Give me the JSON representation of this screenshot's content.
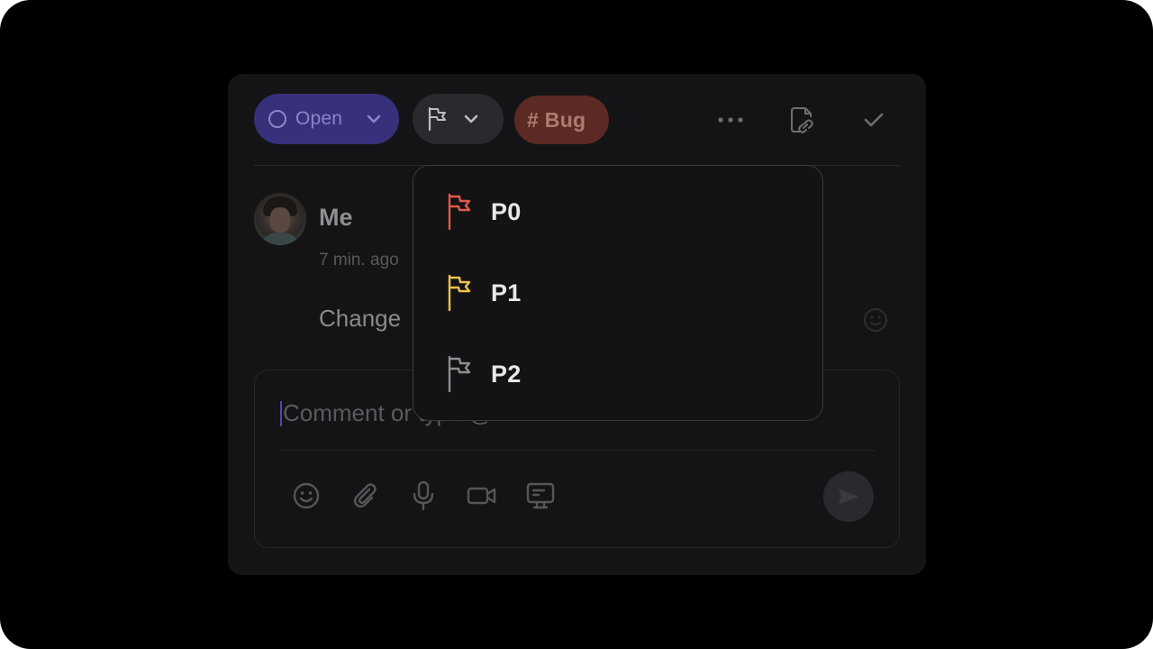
{
  "toolbar": {
    "status_label": "Open",
    "tag_label": "# Bug"
  },
  "comment": {
    "author": "Me",
    "time": "7 min. ago",
    "text": "Change"
  },
  "composer": {
    "placeholder": "Comment or type @"
  },
  "priority_menu": {
    "options": [
      {
        "label": "P0",
        "color": "#e4584c"
      },
      {
        "label": "P1",
        "color": "#f2c14e"
      },
      {
        "label": "P2",
        "color": "#8e8e93"
      }
    ]
  },
  "colors": {
    "status_bg": "#37307a",
    "tag_bg": "#5b2a24",
    "card_bg": "#141416"
  }
}
